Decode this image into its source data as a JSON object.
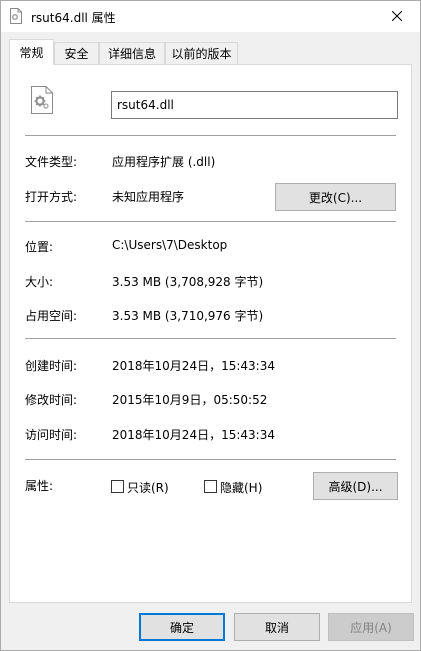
{
  "window": {
    "title": "rsut64.dll 属性"
  },
  "tabs": [
    {
      "label": "常规",
      "active": true
    },
    {
      "label": "安全",
      "active": false
    },
    {
      "label": "详细信息",
      "active": false
    },
    {
      "label": "以前的版本",
      "active": false
    }
  ],
  "general": {
    "file_name": "rsut64.dll",
    "file_type_label": "文件类型:",
    "file_type_value": "应用程序扩展 (.dll)",
    "opens_with_label": "打开方式:",
    "opens_with_value": "未知应用程序",
    "change_button": "更改(C)...",
    "location_label": "位置:",
    "location_value": "C:\\Users\\7\\Desktop",
    "size_label": "大小:",
    "size_value": "3.53 MB (3,708,928 字节)",
    "size_on_disk_label": "占用空间:",
    "size_on_disk_value": "3.53 MB (3,710,976 字节)",
    "created_label": "创建时间:",
    "created_value": "2018年10月24日，15:43:34",
    "modified_label": "修改时间:",
    "modified_value": "2015年10月9日，05:50:52",
    "accessed_label": "访问时间:",
    "accessed_value": "2018年10月24日，15:43:34",
    "attributes_label": "属性:",
    "readonly_label": "只读(R)",
    "readonly_checked": false,
    "hidden_label": "隐藏(H)",
    "hidden_checked": false,
    "advanced_button": "高级(D)..."
  },
  "footer": {
    "ok_button": "确定",
    "cancel_button": "取消",
    "apply_button": "应用(A)"
  },
  "icons": {
    "title": "document-gear-icon",
    "file": "document-gear-icon",
    "close": "close-icon"
  }
}
